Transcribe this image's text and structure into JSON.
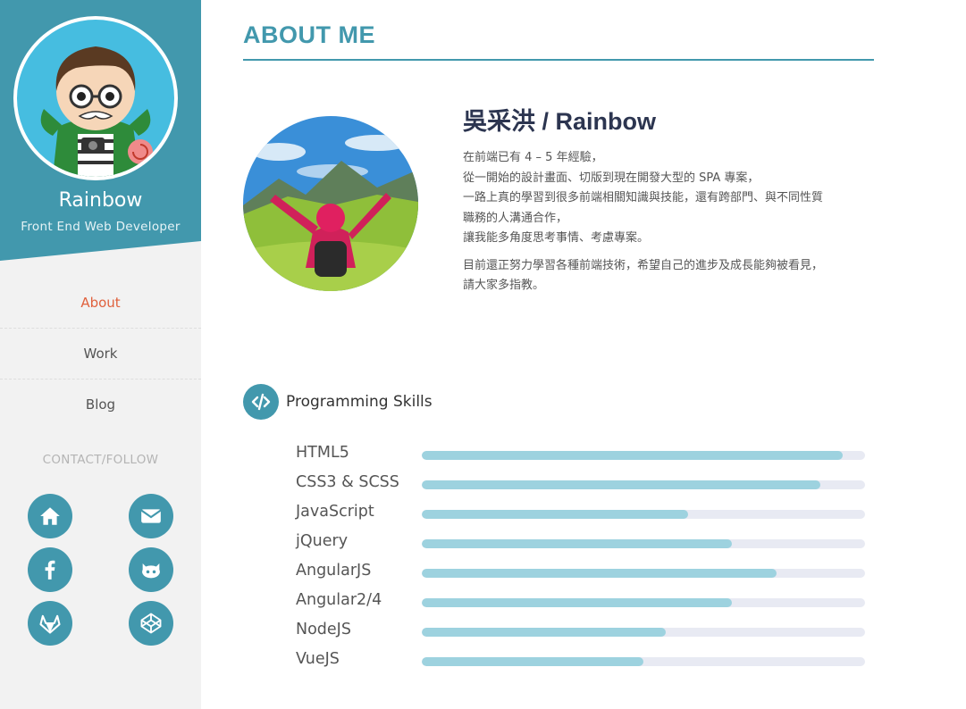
{
  "sidebar": {
    "name": "Rainbow",
    "role": "Front End Web Developer",
    "nav": [
      {
        "label": "About",
        "active": true
      },
      {
        "label": "Work",
        "active": false
      },
      {
        "label": "Blog",
        "active": false
      }
    ],
    "contact_title": "CONTACT/FOLLOW",
    "social": [
      "home-icon",
      "mail-icon",
      "facebook-icon",
      "github-icon",
      "gitlab-icon",
      "codepen-icon"
    ]
  },
  "main": {
    "title": "ABOUT ME",
    "person_name": "吳采洪 / Rainbow",
    "bio_p1": [
      "在前端已有 4 – 5 年經驗，",
      "從一開始的設計畫面、切版到現在開發大型的 SPA 專案，",
      "一路上真的學習到很多前端相關知識與技能，還有跨部門、與不同性質",
      "職務的人溝通合作，",
      "讓我能多角度思考事情、考慮專案。"
    ],
    "bio_p2": [
      "目前還正努力學習各種前端技術，希望自己的進步及成長能夠被看見，",
      "請大家多指教。"
    ]
  },
  "skills": {
    "title": "Programming Skills",
    "items": [
      {
        "name": "HTML5",
        "level": 0.95
      },
      {
        "name": "CSS3 & SCSS",
        "level": 0.9
      },
      {
        "name": "JavaScript",
        "level": 0.6
      },
      {
        "name": "jQuery",
        "level": 0.7
      },
      {
        "name": "AngularJS",
        "level": 0.8
      },
      {
        "name": "Angular2/4",
        "level": 0.7
      },
      {
        "name": "NodeJS",
        "level": 0.55
      },
      {
        "name": "VueJS",
        "level": 0.5
      }
    ]
  },
  "colors": {
    "accent": "#4298ad",
    "active_nav": "#e0613d",
    "bar_fill": "#9dd2df",
    "bar_track": "#e8eaf3"
  }
}
